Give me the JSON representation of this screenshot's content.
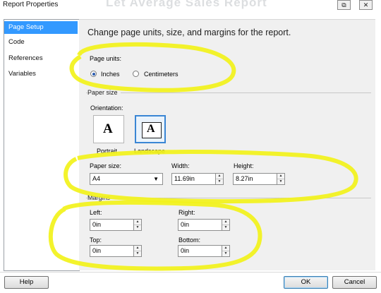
{
  "window": {
    "title": "Report Properties",
    "ghost_text": "Let Average Sales Report",
    "restore_glyph": "⧉",
    "close_glyph": "✕"
  },
  "sidebar": {
    "items": [
      {
        "label": "Page Setup",
        "selected": true
      },
      {
        "label": "Code",
        "selected": false
      },
      {
        "label": "References",
        "selected": false
      },
      {
        "label": "Variables",
        "selected": false
      }
    ]
  },
  "main": {
    "heading": "Change page units, size, and margins for the report.",
    "page_units": {
      "label": "Page units:",
      "options": [
        {
          "label": "Inches",
          "selected": true
        },
        {
          "label": "Centimeters",
          "selected": false
        }
      ]
    },
    "paper_size": {
      "section_title": "Paper size",
      "orientation_label": "Orientation:",
      "orientations": [
        {
          "label": "Portrait",
          "glyph": "A",
          "selected": false
        },
        {
          "label": "Landscape",
          "glyph": "A",
          "selected": true
        }
      ],
      "size_label": "Paper size:",
      "size_value": "A4",
      "width_label": "Width:",
      "width_value": "11.69in",
      "height_label": "Height:",
      "height_value": "8.27in"
    },
    "margins": {
      "section_title": "Margins",
      "left_label": "Left:",
      "left_value": "0in",
      "right_label": "Right:",
      "right_value": "0in",
      "top_label": "Top:",
      "top_value": "0in",
      "bottom_label": "Bottom:",
      "bottom_value": "0in"
    }
  },
  "footer": {
    "help_label": "Help",
    "ok_label": "OK",
    "cancel_label": "Cancel"
  },
  "colors": {
    "selection": "#3399ff",
    "highlight_marker": "#f2f21a",
    "panel_bg": "#f0f0f0"
  }
}
